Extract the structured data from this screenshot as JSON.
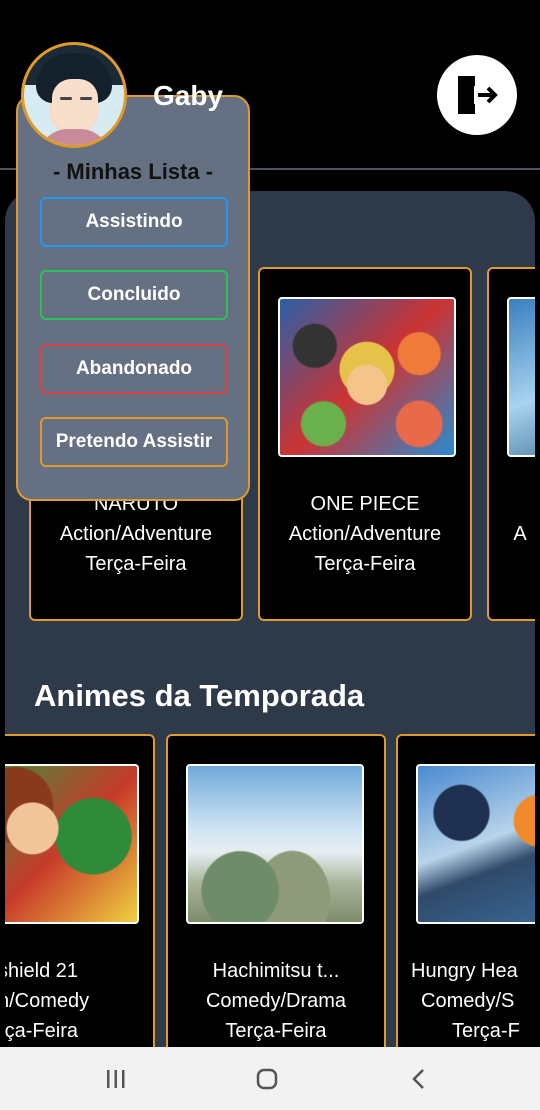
{
  "header": {
    "username": "Gaby"
  },
  "dropdown": {
    "title": "- Minhas Lista -",
    "items": [
      {
        "label": "Assistindo",
        "color": "#2196f3"
      },
      {
        "label": "Concluido",
        "color": "#2fbf5a"
      },
      {
        "label": "Abandonado",
        "color": "#e0404a"
      },
      {
        "label": "Pretendo Assistir",
        "color": "#e09a2a"
      }
    ]
  },
  "row1": [
    {
      "title": "NARUTO",
      "genre": "Action/Adventure",
      "day": "Terça-Feira"
    },
    {
      "title": "ONE PIECE",
      "genre": "Action/Adventure",
      "day": "Terça-Feira"
    },
    {
      "title": "",
      "genre": "A",
      "day": ""
    }
  ],
  "seasonal": {
    "title": "Animes da Temporada",
    "items": [
      {
        "title": "shield 21",
        "genre": "on/Comedy",
        "day": "rça-Feira"
      },
      {
        "title": "Hachimitsu t...",
        "genre": "Comedy/Drama",
        "day": "Terça-Feira"
      },
      {
        "title": "Hungry Hea",
        "genre": "Comedy/S",
        "day": "Terça-F"
      }
    ]
  },
  "colors": {
    "accent": "#e09a2a",
    "card_bg": "#2e3a4a"
  },
  "icons": {
    "logout": "logout-door-icon"
  }
}
